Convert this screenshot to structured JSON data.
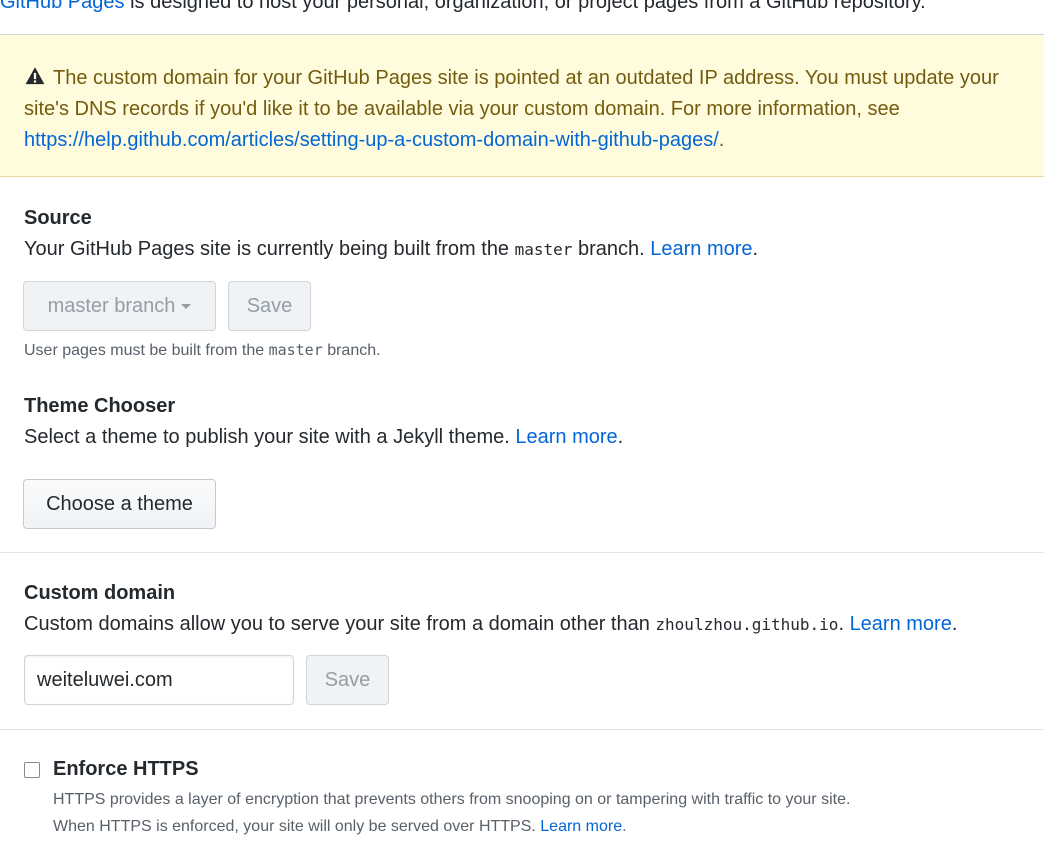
{
  "intro": {
    "link_text": "GitHub Pages",
    "text": " is designed to host your personal, organization, or project pages from a GitHub repository."
  },
  "warning": {
    "icon": "alert-icon",
    "text": "The custom domain for your GitHub Pages site is pointed at an outdated IP address. You must update your site's DNS records if you'd like it to be available via your custom domain. For more information, see ",
    "link": "https://help.github.com/articles/setting-up-a-custom-domain-with-github-pages/",
    "after": "."
  },
  "source": {
    "title": "Source",
    "desc_before": "Your GitHub Pages site is currently being built from the ",
    "desc_code": "master",
    "desc_after": " branch. ",
    "learn_more": "Learn more",
    "period": ".",
    "branch_select": "master branch",
    "save": "Save",
    "note_before": "User pages must be built from the ",
    "note_code": "master",
    "note_after": " branch."
  },
  "theme": {
    "title": "Theme Chooser",
    "desc": "Select a theme to publish your site with a Jekyll theme. ",
    "learn_more": "Learn more",
    "period": ".",
    "button": "Choose a theme"
  },
  "custom_domain": {
    "title": "Custom domain",
    "desc": "Custom domains allow you to serve your site from a domain other than ",
    "desc_code": "zhoulzhou.github.io",
    "desc_after": ". ",
    "learn_more": "Learn more",
    "period": ".",
    "input_value": "weiteluwei.com",
    "save": "Save"
  },
  "https": {
    "label": "Enforce HTTPS",
    "desc1": "HTTPS provides a layer of encryption that prevents others from snooping on or tampering with traffic to your site.",
    "desc2": "When HTTPS is enforced, your site will only be served over HTTPS. ",
    "learn_more": "Learn more",
    "period": ".",
    "checked": false
  }
}
